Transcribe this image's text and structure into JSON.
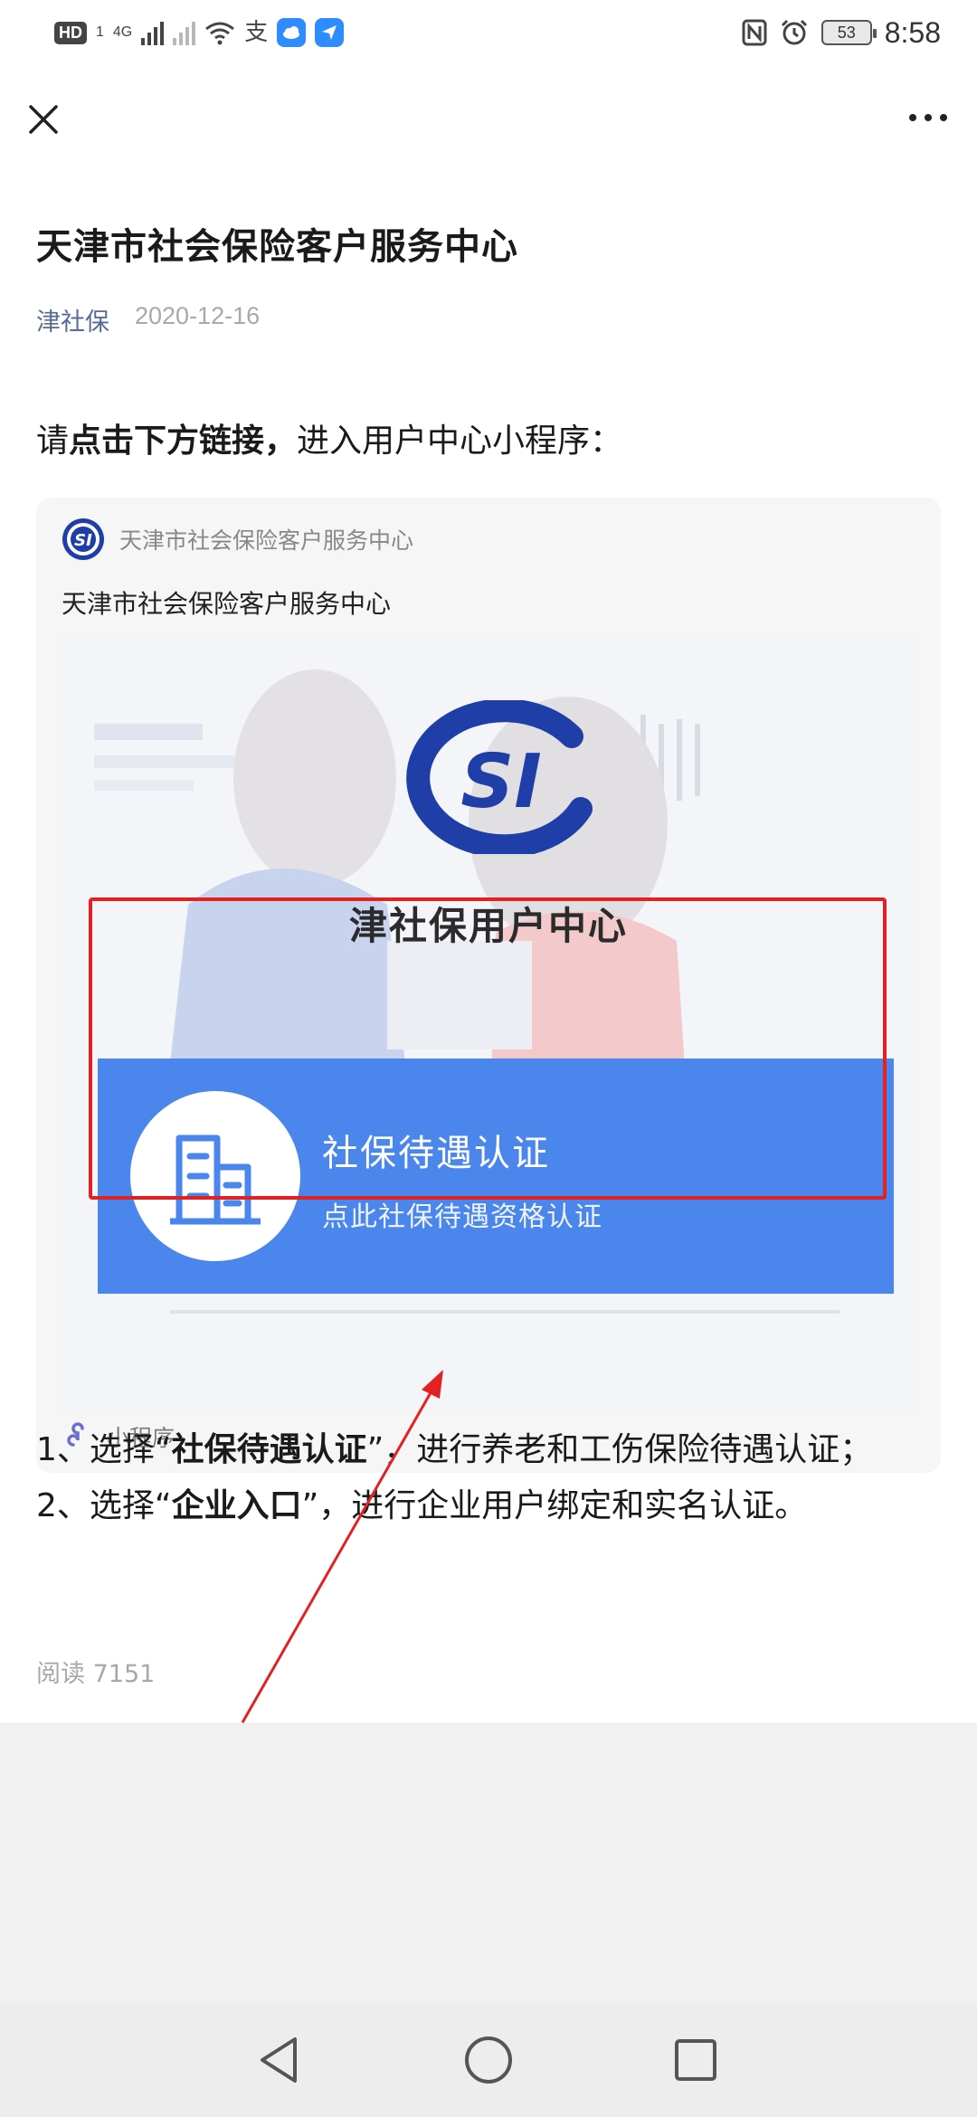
{
  "status_bar": {
    "hd_label": "HD",
    "hd_sub": "1",
    "network_label": "4G",
    "carrier_icon": "alipay-icon",
    "battery_level": "53",
    "time": "8:58"
  },
  "article": {
    "title": "天津市社会保险客户服务中心",
    "account": "津社保",
    "date": "2020-12-16",
    "intro_prefix": "请",
    "intro_bold": "点击下方链接，",
    "intro_suffix": "进入用户中心小程序：",
    "mini_program": {
      "source_name": "天津市社会保险客户服务中心",
      "description": "天津市社会保险客户服务中心",
      "thumb_heading": "津社保用户中心",
      "banner_title": "社保待遇认证",
      "banner_subtitle": "点此社保待遇资格认证",
      "type_label": "小程序"
    },
    "step1_prefix": "1、选择“",
    "step1_bold": "社保待遇认证",
    "step1_suffix": "”，进行养老和工伤保险待遇认证；",
    "step2_prefix": "2、选择“",
    "step2_bold": "企业入口",
    "step2_suffix": "”，进行企业用户绑定和实名认证。",
    "read_count": "阅读 7151"
  },
  "annotation": {
    "highlight_color": "#e22222"
  },
  "colors": {
    "link_blue": "#576b95",
    "banner_blue": "#4a86ec",
    "logo_blue": "#1f3ea8"
  }
}
